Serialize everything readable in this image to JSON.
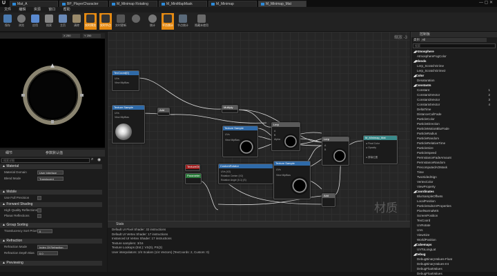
{
  "window": {
    "tabs": [
      "Mat_A",
      "BP_PlayerCharacter",
      "M_Minimap Rotating",
      "M_MiniMapMask",
      "M_Minimap",
      "M_Minimap_Mat"
    ]
  },
  "menu": [
    "文件",
    "编辑",
    "资源",
    "窗口",
    "帮助"
  ],
  "toolbar": [
    "保存",
    "浏览",
    "应用",
    "搜索",
    "主页",
    "清除",
    "实时预览",
    "实时节点",
    "实时更新",
    "统计",
    "平台统计",
    "节点统计",
    "隐藏未使用"
  ],
  "preview": {
    "label": "预览"
  },
  "details": {
    "tab1": "细节",
    "tab2": "参数默认值",
    "search": "搜索详细",
    "sections": {
      "material": "Material",
      "mobile": "Mobile",
      "forward": "Forward Shading",
      "group": "Group Sorting",
      "refraction": "Refraction",
      "preview": "Previewing"
    },
    "rows": {
      "domain_label": "Material Domain",
      "domain_value": "User Interface",
      "blend_label": "Blend Mode",
      "blend_value": "Translucent",
      "precision_label": "Use Full Precision",
      "reflections_label": "High Quality Reflections",
      "planar_label": "Planar Reflections",
      "translucency_label": "Translucency Sort Priority",
      "translucency_value": "0",
      "refraction_label": "Refraction Mode",
      "refraction_value": "Index Of Refraction",
      "depth_label": "Refraction Depth Bias",
      "depth_value": "0.0"
    }
  },
  "graph": {
    "zoom": "缩放 -3",
    "watermark": "材质",
    "nodes": {
      "texcoord": "TexCoord[0]",
      "mult": "Multiply",
      "lerp": "Lerp",
      "lerp2": "Lerp",
      "add": "Add",
      "sample1": "Texture Sample",
      "sample2": "Texture Sample",
      "sample3": "Texture Sample",
      "custom_rot": "CustomRotator",
      "param": "TextureObject",
      "scalar": "Parameter",
      "result": "M_Minimap_Mat"
    }
  },
  "stats": {
    "title": "Stats",
    "lines": [
      "Default UI Pixel Shader: 32 instructions",
      "Default UI Vertex Shader: 17 instructions",
      "Instanced UI Vertex Shader: 17 instructions",
      "Texture samplers: 3/16",
      "Texture Lookups (Est.): VS(0), PS(3)",
      "User interpolators: 2/4 Scalars (1/4 Vectors) (TexCoords: 2, Custom: 0)"
    ]
  },
  "palette": {
    "title": "控制板",
    "filter": "All",
    "search": "搜索",
    "items": [
      {
        "t": "Atmosphere",
        "cat": true
      },
      {
        "t": "AtmosphereFogColor"
      },
      {
        "t": "Blends",
        "cat": true
      },
      {
        "t": "Lerp_ScratchGrime"
      },
      {
        "t": "Lerp_ScratchGrime2"
      },
      {
        "t": "Color",
        "cat": true
      },
      {
        "t": "Desaturation"
      },
      {
        "t": "Constants",
        "cat": true
      },
      {
        "t": "Constant",
        "n": "1"
      },
      {
        "t": "Constant2Vector",
        "n": "2"
      },
      {
        "t": "Constant3Vector",
        "n": "3"
      },
      {
        "t": "Constant4Vector",
        "n": "4"
      },
      {
        "t": "DeltaTime"
      },
      {
        "t": "DistanceCullFade"
      },
      {
        "t": "ParticleColor"
      },
      {
        "t": "ParticleDirection"
      },
      {
        "t": "ParticleMotionBlurFade"
      },
      {
        "t": "ParticleRadius"
      },
      {
        "t": "ParticleRandom"
      },
      {
        "t": "ParticleRelativeTime"
      },
      {
        "t": "ParticleSize"
      },
      {
        "t": "ParticleSpeed"
      },
      {
        "t": "PerInstanceFadeAmount"
      },
      {
        "t": "PerInstanceRandom"
      },
      {
        "t": "PrecomputedAOMask"
      },
      {
        "t": "Time"
      },
      {
        "t": "TwoSidedSign"
      },
      {
        "t": "VertexColor"
      },
      {
        "t": "ViewProperty"
      },
      {
        "t": "Coordinates",
        "cat": true
      },
      {
        "t": "BlurSampleOffsets"
      },
      {
        "t": "LocalPosition"
      },
      {
        "t": "ParticleSubUVProperties"
      },
      {
        "t": "PixelNormalWS"
      },
      {
        "t": "ScreenPosition"
      },
      {
        "t": "TexCoord"
      },
      {
        "t": "UVRotate"
      },
      {
        "t": "UVs"
      },
      {
        "t": "ViewSize"
      },
      {
        "t": "WorldPosition"
      },
      {
        "t": "Cubemaps",
        "cat": true
      },
      {
        "t": "UVToLongLat"
      },
      {
        "t": "Debug",
        "cat": true
      },
      {
        "t": "DebugBinaryValues-Float"
      },
      {
        "t": "DebugBinaryValues-Int"
      },
      {
        "t": "DebugFloatValues"
      },
      {
        "t": "DebugFloatValues"
      }
    ]
  }
}
